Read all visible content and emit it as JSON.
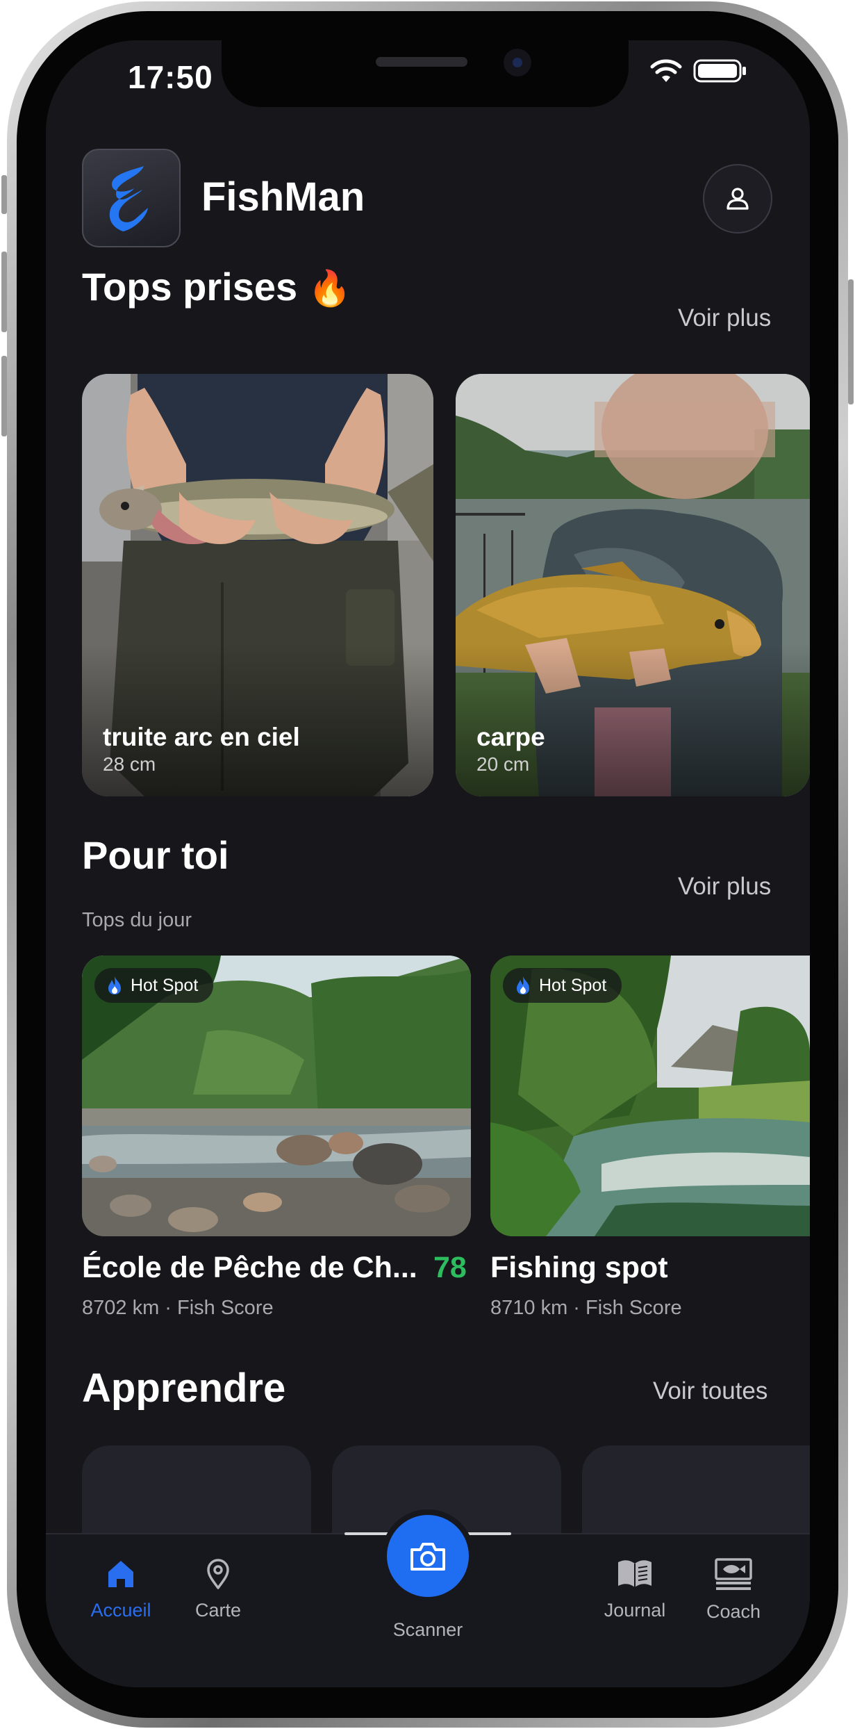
{
  "status": {
    "time": "17:50"
  },
  "header": {
    "app_name": "FishMan",
    "logo_icon": "flame-s-logo-icon",
    "profile_icon": "user-icon"
  },
  "top_catches": {
    "title": "Tops prises",
    "emoji": "🔥",
    "see_more": "Voir plus",
    "items": [
      {
        "name": "truite arc en ciel",
        "size": "28 cm"
      },
      {
        "name": "carpe",
        "size": "20 cm"
      }
    ]
  },
  "for_you": {
    "title": "Pour toi",
    "subtitle": "Tops du jour",
    "see_more": "Voir plus",
    "items": [
      {
        "badge": "Hot Spot",
        "title": "École de Pêche de Ch...",
        "meta": "8702 km · Fish Score",
        "score": "78"
      },
      {
        "badge": "Hot Spot",
        "title": "Fishing spot",
        "meta": "8710 km · Fish Score"
      }
    ]
  },
  "learn": {
    "title": "Apprendre",
    "see_all": "Voir toutes"
  },
  "tabbar": {
    "accent": "#2a6ef0",
    "tabs": [
      {
        "label": "Accueil",
        "icon": "home-icon",
        "active": true
      },
      {
        "label": "Carte",
        "icon": "map-pin-icon"
      },
      {
        "label": "Scanner",
        "icon": "camera-icon"
      },
      {
        "label": "Journal",
        "icon": "book-icon"
      },
      {
        "label": "Coach",
        "icon": "fish-board-icon"
      }
    ]
  }
}
